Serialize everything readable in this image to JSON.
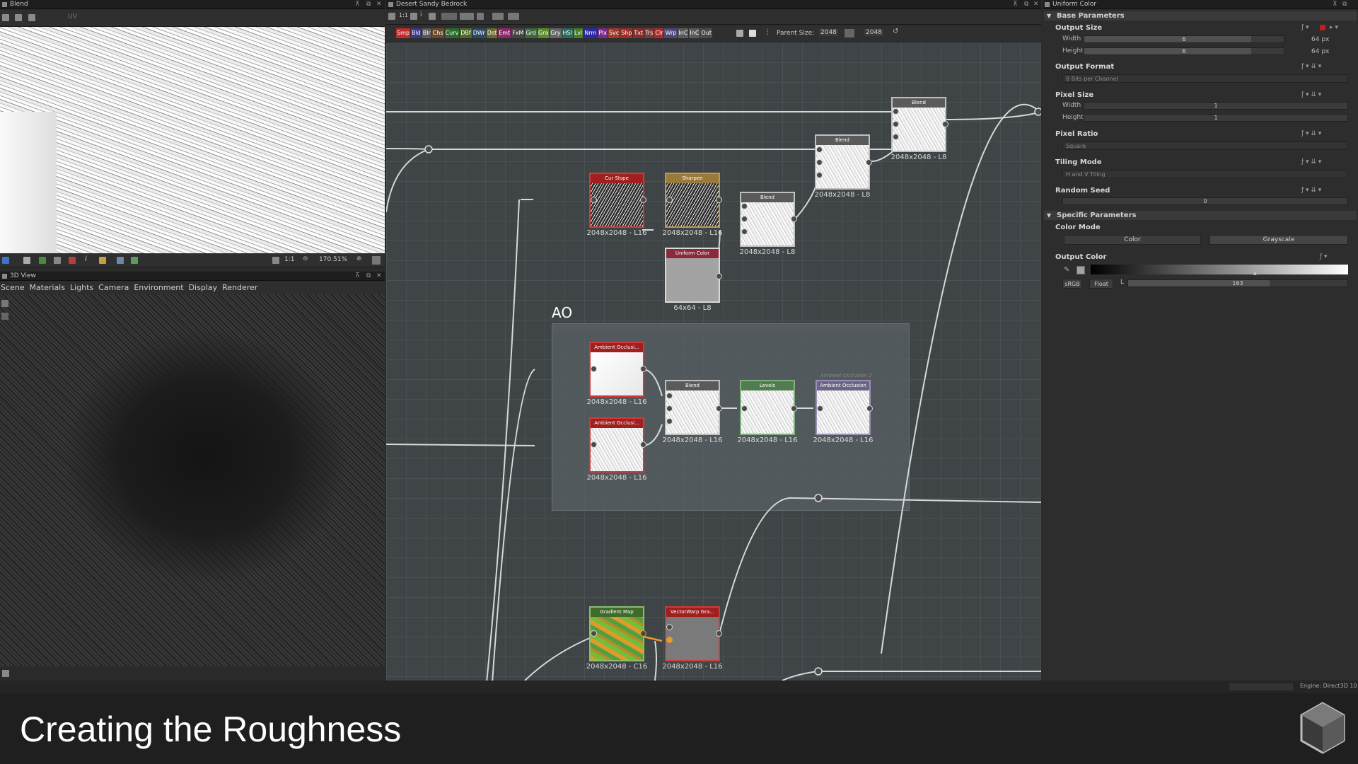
{
  "colors": {
    "accent": "#c01e1e",
    "dark": "#1f1f1f",
    "panel": "#2b2b2b",
    "graph": "#3a3f41"
  },
  "left_top": {
    "title": "Blend",
    "toolbar_label": "UV",
    "zoom": "170.51%",
    "ratio": "1:1"
  },
  "view3d": {
    "title": "3D View",
    "menu": [
      "Scene",
      "Materials",
      "Lights",
      "Camera",
      "Environment",
      "Display",
      "Renderer"
    ]
  },
  "graph": {
    "title": "Desert Sandy Bedrock",
    "ratio": "1:1",
    "node_tags": [
      "Smp",
      "Bld",
      "Blr",
      "Chs",
      "Curv",
      "DBf",
      "DWr",
      "Dst",
      "Emt",
      "FxM",
      "Grd",
      "Gra",
      "Gry",
      "HSl",
      "Lvl",
      "Nrm",
      "Plx",
      "Svc",
      "Shp",
      "Txt",
      "Trs",
      "Clr",
      "Wrp",
      "InC",
      "InC",
      "Out"
    ],
    "parent_size_label": "Parent Size:",
    "parent_size": "2048",
    "parent_size2": "2048",
    "frame_title": "AO",
    "frame_note": "Ambient Occlusion 2",
    "nodes": {
      "blend_top": {
        "head": "Blend",
        "label": "2048x2048 - L8"
      },
      "blend_mid": {
        "head": "Blend",
        "label": "2048x2048 - L8"
      },
      "curslope": {
        "head": "Cur Slope",
        "label": "2048x2048 - L16"
      },
      "sharpen": {
        "head": "Sharpen",
        "label": "2048x2048 - L16"
      },
      "blend_low": {
        "head": "Blend",
        "label": "2048x2048 - L8"
      },
      "uniform": {
        "head": "Uniform Color",
        "label": "64x64 - L8"
      },
      "ao1": {
        "head": "Ambient Occlusi...",
        "label": "2048x2048 - L16"
      },
      "ao2": {
        "head": "Ambient Occlusi...",
        "label": "2048x2048 - L16"
      },
      "blend_ao": {
        "head": "Blend",
        "label": "2048x2048 - L16"
      },
      "levels": {
        "head": "Levels",
        "label": "2048x2048 - L16"
      },
      "ao3": {
        "head": "Ambient Occlusion",
        "label": "2048x2048 - L16"
      },
      "gradient": {
        "head": "Gradient Map",
        "label": "2048x2048 - C16"
      },
      "vectorwarp": {
        "head": "VectorWarp Gra...",
        "label": "2048x2048 - L16"
      }
    }
  },
  "props": {
    "title": "Uniform Color",
    "base_section": "Base Parameters",
    "output_size": "Output Size",
    "width_label": "Width",
    "width_val": "6",
    "width_unit": "64 px",
    "height_label": "Height",
    "height_val": "6",
    "height_unit": "64 px",
    "output_format": "Output Format",
    "output_format_val": "8 Bits per Channel",
    "pixel_size": "Pixel Size",
    "ps_width": "Width",
    "ps_width_val": "1",
    "ps_height": "Height",
    "ps_height_val": "1",
    "pixel_ratio": "Pixel Ratio",
    "pixel_ratio_val": "Square",
    "tiling_mode": "Tiling Mode",
    "tiling_val": "H and V Tiling",
    "random_seed": "Random Seed",
    "seed_val": "0",
    "specific_section": "Specific Parameters",
    "color_mode": "Color Mode",
    "color_btn": "Color",
    "gray_btn": "Grayscale",
    "output_color": "Output Color",
    "srgb": "sRGB",
    "float": "Float",
    "l_label": "L",
    "l_val": "163",
    "engine": "Engine: Direct3D 10"
  },
  "caption": "Creating the Roughness"
}
